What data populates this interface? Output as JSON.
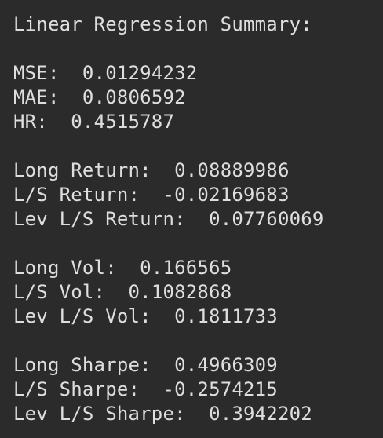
{
  "title": "Linear Regression Summary:",
  "error_metrics": [
    {
      "label": "MSE:",
      "value": "0.01294232"
    },
    {
      "label": "MAE:",
      "value": "0.0806592"
    },
    {
      "label": "HR:",
      "value": "0.4515787"
    }
  ],
  "returns": [
    {
      "label": "Long Return:",
      "value": "0.08889986"
    },
    {
      "label": "L/S Return:",
      "value": "-0.02169683"
    },
    {
      "label": "Lev L/S Return:",
      "value": "0.07760069"
    }
  ],
  "volatility": [
    {
      "label": "Long Vol:",
      "value": "0.166565"
    },
    {
      "label": "L/S Vol:",
      "value": "0.1082868"
    },
    {
      "label": "Lev L/S Vol:",
      "value": "0.1811733"
    }
  ],
  "sharpe": [
    {
      "label": "Long Sharpe:",
      "value": "0.4966309"
    },
    {
      "label": "L/S Sharpe:",
      "value": "-0.2574215"
    },
    {
      "label": "Lev L/S Sharpe:",
      "value": "0.3942202"
    }
  ],
  "colors": {
    "background": "#2b2b2b",
    "text": "#dedede"
  }
}
